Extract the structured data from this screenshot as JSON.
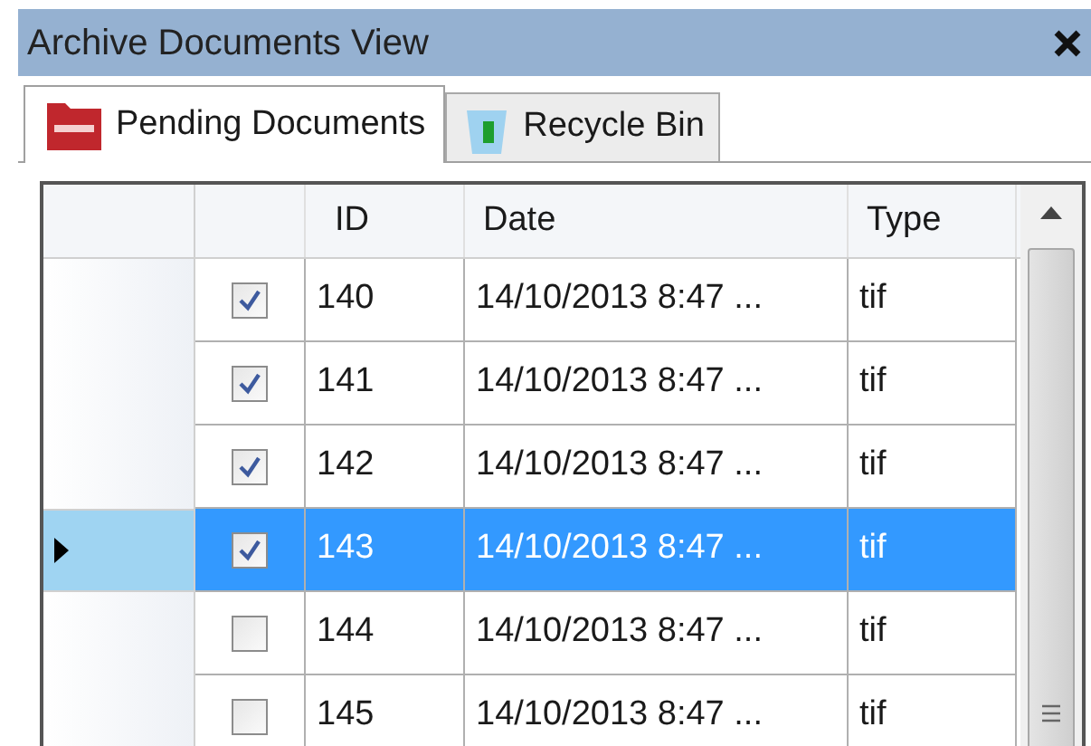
{
  "window": {
    "title": "Archive Documents View"
  },
  "tabs": [
    {
      "label": "Pending Documents",
      "selected": true,
      "kind": "pending"
    },
    {
      "label": "Recycle Bin",
      "selected": false,
      "kind": "bin"
    }
  ],
  "table": {
    "columns": [
      "ID",
      "Date",
      "Type"
    ],
    "rows": [
      {
        "id": "140",
        "date": "14/10/2013 8:47 ...",
        "type": "tif",
        "checked": true,
        "selected": false
      },
      {
        "id": "141",
        "date": "14/10/2013 8:47 ...",
        "type": "tif",
        "checked": true,
        "selected": false
      },
      {
        "id": "142",
        "date": "14/10/2013 8:47 ...",
        "type": "tif",
        "checked": true,
        "selected": false
      },
      {
        "id": "143",
        "date": "14/10/2013 8:47 ...",
        "type": "tif",
        "checked": true,
        "selected": true
      },
      {
        "id": "144",
        "date": "14/10/2013 8:47 ...",
        "type": "tif",
        "checked": false,
        "selected": false
      },
      {
        "id": "145",
        "date": "14/10/2013 8:47 ...",
        "type": "tif",
        "checked": false,
        "selected": false
      }
    ]
  }
}
